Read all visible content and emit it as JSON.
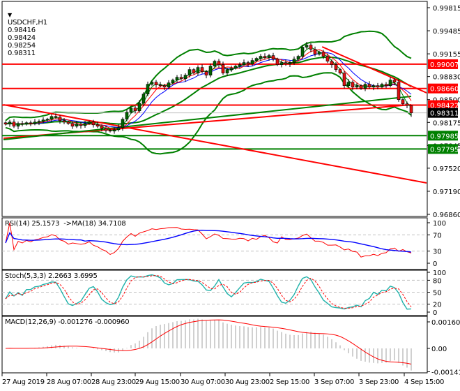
{
  "header": {
    "symbol": "USDCHF,H1",
    "open": "0.98416",
    "high": "0.98424",
    "low": "0.98254",
    "close": "0.98311"
  },
  "indicators": {
    "rsi": "RSI(14) 25.1573  ->MA(18) 34.7108",
    "stoch": "Stoch(5,3,3) 2.2663 3.6995",
    "macd": "MACD(12,26,9) -0.001276 -0.000960"
  },
  "colors": {
    "bull": "#006400",
    "bear": "#e01010",
    "band": "#008000",
    "resistance": "#ff0000",
    "support": "#008000",
    "ma_blue": "#0000ff",
    "ma_red": "#ff0000",
    "ma_green": "#008000"
  },
  "chart_data": {
    "type": "candlestick",
    "title": "USDCHF,H1",
    "price_axis_ticks": [
      "0.99815",
      "0.99485",
      "0.99155",
      "0.98830",
      "0.98500",
      "0.98175",
      "0.97845",
      "0.97520",
      "0.97190",
      "0.96860"
    ],
    "ylim": [
      0.9686,
      0.99815
    ],
    "time_axis_ticks": [
      "27 Aug 2019",
      "28 Aug 07:00",
      "28 Aug 23:00",
      "29 Aug 15:00",
      "30 Aug 07:00",
      "30 Aug 23:00",
      "2 Sep 15:00",
      "3 Sep 07:00",
      "3 Sep 23:00",
      "4 Sep 15:00"
    ],
    "closes": [
      0.9815,
      0.9818,
      0.9812,
      0.9816,
      0.9815,
      0.9817,
      0.9816,
      0.9818,
      0.9819,
      0.9821,
      0.9822,
      0.9826,
      0.9825,
      0.982,
      0.9818,
      0.9816,
      0.9812,
      0.9815,
      0.9813,
      0.9816,
      0.9818,
      0.9814,
      0.9812,
      0.9809,
      0.9806,
      0.9805,
      0.9807,
      0.981,
      0.9822,
      0.9832,
      0.9838,
      0.9834,
      0.9845,
      0.9858,
      0.9872,
      0.9875,
      0.9871,
      0.987,
      0.9868,
      0.9874,
      0.9878,
      0.9882,
      0.988,
      0.9885,
      0.9893,
      0.9888,
      0.9896,
      0.989,
      0.9885,
      0.9898,
      0.9905,
      0.99,
      0.9888,
      0.9893,
      0.9895,
      0.9898,
      0.99,
      0.9903,
      0.9901,
      0.9906,
      0.9909,
      0.9912,
      0.991,
      0.9913,
      0.9908,
      0.99,
      0.9903,
      0.9901,
      0.9903,
      0.9908,
      0.9912,
      0.9925,
      0.9928,
      0.9922,
      0.9915,
      0.9918,
      0.9912,
      0.9905,
      0.99,
      0.9893,
      0.9888,
      0.987,
      0.9875,
      0.9868,
      0.987,
      0.9866,
      0.9872,
      0.9868,
      0.987,
      0.9868,
      0.9872,
      0.987,
      0.9878,
      0.9875,
      0.985,
      0.9844,
      0.98416,
      0.98311
    ],
    "current_price": {
      "value": 0.98311,
      "label": "0.98311"
    },
    "horizontal_levels": [
      {
        "label": "0.99007",
        "value": 0.99007,
        "kind": "resistance"
      },
      {
        "label": "0.98660",
        "value": 0.9866,
        "kind": "resistance"
      },
      {
        "label": "0.98422",
        "value": 0.98422,
        "kind": "resistance"
      },
      {
        "label": "0.97985",
        "value": 0.97985,
        "kind": "support"
      },
      {
        "label": "0.97795",
        "value": 0.97795,
        "kind": "support"
      }
    ],
    "trendlines": [
      {
        "from": [
          -0.5,
          0.98427
        ],
        "to": [
          100.7,
          0.97309
        ],
        "kind": "resistance"
      },
      {
        "from": [
          -0.5,
          0.97948
        ],
        "to": [
          97,
          0.98427
        ],
        "kind": "resistance"
      },
      {
        "from": [
          -0.5,
          0.97928
        ],
        "to": [
          97,
          0.98547
        ],
        "kind": "support"
      },
      {
        "from": [
          75.7,
          0.99256
        ],
        "to": [
          100.7,
          0.98597
        ],
        "kind": "resistance"
      }
    ],
    "rsi_axis": [
      "100",
      "70",
      "30",
      "0"
    ],
    "stoch_axis": [
      "100",
      "80",
      "50",
      "20",
      "0"
    ],
    "macd_axis": [
      "0.001604",
      "0.00",
      "-0.001414"
    ]
  }
}
